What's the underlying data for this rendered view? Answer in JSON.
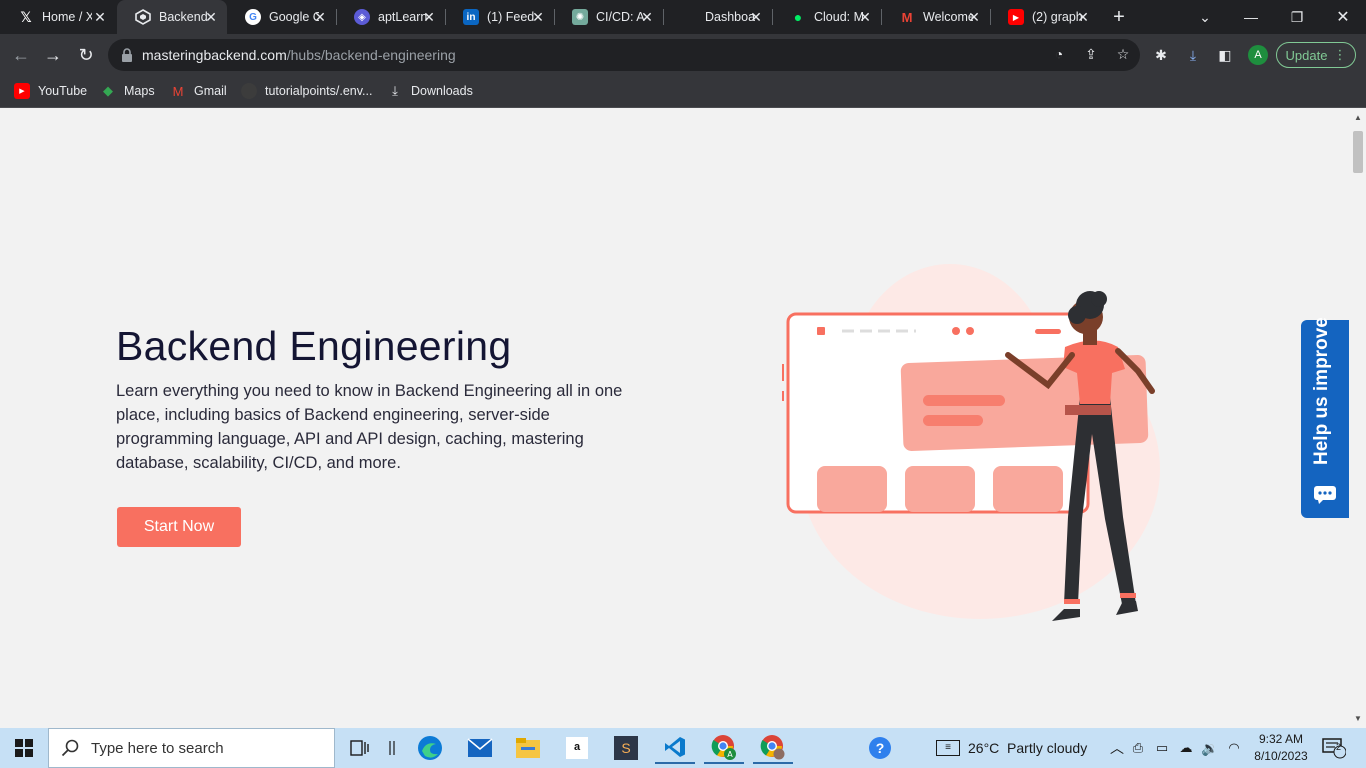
{
  "tabs": [
    {
      "title": "Home / X",
      "icon": "x-logo-icon"
    },
    {
      "title": "Backend Engineering",
      "icon": "backend-logo-icon",
      "active": true
    },
    {
      "title": "Google Cloud",
      "icon": "google-icon"
    },
    {
      "title": "aptLearn",
      "icon": "aptlearn-icon"
    },
    {
      "title": "(1) Feed",
      "icon": "linkedin-icon"
    },
    {
      "title": "CI/CD: A",
      "icon": "chatgpt-icon"
    },
    {
      "title": "Dashboard",
      "icon": "dashboard-icon"
    },
    {
      "title": "Cloud: M",
      "icon": "mongodb-icon"
    },
    {
      "title": "Welcome",
      "icon": "gmail-icon"
    },
    {
      "title": "(2) graph",
      "icon": "youtube-icon"
    }
  ],
  "toolbar": {
    "url_host": "masteringbackend.com",
    "url_path": "/hubs/backend-engineering",
    "avatar_letter": "A",
    "update_label": "Update"
  },
  "bookmarks": [
    {
      "label": "YouTube"
    },
    {
      "label": "Maps"
    },
    {
      "label": "Gmail"
    },
    {
      "label": "tutorialpoints/.env..."
    },
    {
      "label": "Downloads"
    }
  ],
  "hero": {
    "title": "Backend Engineering",
    "description": "Learn everything you need to know in Backend Engineering all in one place, including basics of Backend engineering, server-side programming language, API and API design, caching, mastering database, scalability, CI/CD, and more.",
    "cta_label": "Start Now"
  },
  "feedback": {
    "label": "Help us improve"
  },
  "taskbar": {
    "search_placeholder": "Type here to search",
    "weather": "26°C  Partly cloudy",
    "time": "9:32 AM",
    "date": "8/10/2023",
    "notification_count": "2"
  },
  "colors": {
    "accent": "#f87060",
    "title": "#141533",
    "feedback": "#1464c0",
    "chrome_dark": "#202124",
    "chrome_toolbar": "#35363a"
  }
}
